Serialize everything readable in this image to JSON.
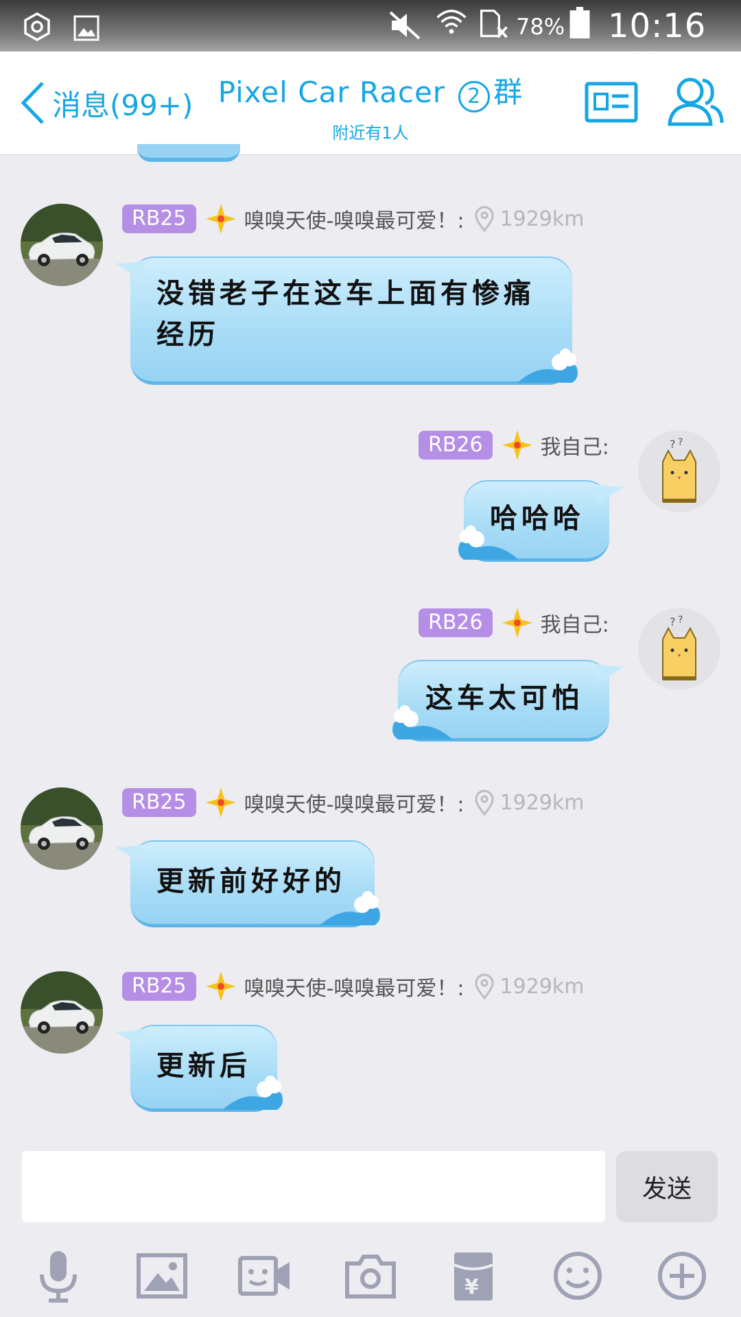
{
  "status_bar": {
    "battery": "78%",
    "time": "10:16 PM"
  },
  "header": {
    "back_label": "消息(99+)",
    "title": "Pixel Car Racer",
    "title_badge": "2",
    "title_suffix": "群",
    "subtitle": "附近有1人"
  },
  "messages": [
    {
      "side": "left",
      "tag": "RB25",
      "nick": "嗅嗅天使-嗅嗅最可爱！:",
      "distance": "1929km",
      "text_line1": "没错老子在这车上面有惨痛",
      "text_line2": "经历"
    },
    {
      "side": "right",
      "tag": "RB26",
      "nick": "我自己:",
      "text": "哈哈哈"
    },
    {
      "side": "right",
      "tag": "RB26",
      "nick": "我自己:",
      "text": "这车太可怕"
    },
    {
      "side": "left",
      "tag": "RB25",
      "nick": "嗅嗅天使-嗅嗅最可爱！:",
      "distance": "1929km",
      "text": "更新前好好的"
    },
    {
      "side": "left",
      "tag": "RB25",
      "nick": "嗅嗅天使-嗅嗅最可爱！:",
      "distance": "1929km",
      "text": "更新后"
    }
  ],
  "input": {
    "value": "",
    "send_label": "发送"
  },
  "toolbar_icons": [
    "microphone-icon",
    "image-icon",
    "video-call-icon",
    "camera-icon",
    "red-packet-icon",
    "emoji-icon",
    "plus-icon"
  ],
  "colors": {
    "accent": "#16a6e4",
    "tag": "#b58ee6",
    "bubble": "#a8dcf6",
    "toolbar_icon": "#9fa2b4"
  }
}
